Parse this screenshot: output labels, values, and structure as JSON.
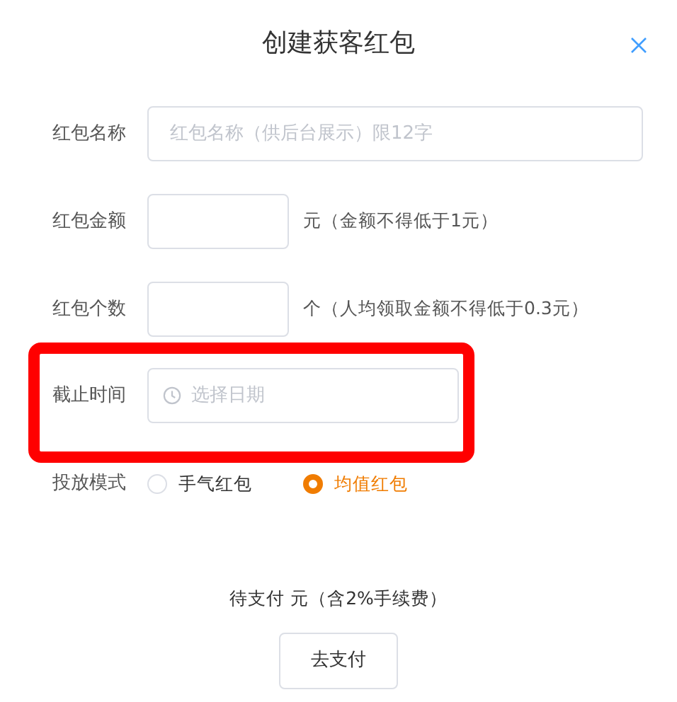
{
  "title": "创建获客红包",
  "fields": [
    {
      "kind": "text",
      "label": "红包名称",
      "placeholder": "红包名称（供后台展示）限12字",
      "highlighted": false
    },
    {
      "kind": "number",
      "label": "红包金额",
      "suffix": "元（金额不得低于1元）",
      "highlighted": false
    },
    {
      "kind": "number",
      "label": "红包个数",
      "suffix": "个（人均领取金额不得低于0.3元）",
      "highlighted": false
    },
    {
      "kind": "date",
      "label": "截止时间",
      "placeholder": "选择日期",
      "highlighted": true
    }
  ],
  "mode": {
    "label": "投放模式",
    "options": [
      {
        "label": "手气红包",
        "selected": false
      },
      {
        "label": "均值红包",
        "selected": true
      }
    ]
  },
  "total_text": "待支付 元（含2%手续费）",
  "pay_button": "去支付"
}
